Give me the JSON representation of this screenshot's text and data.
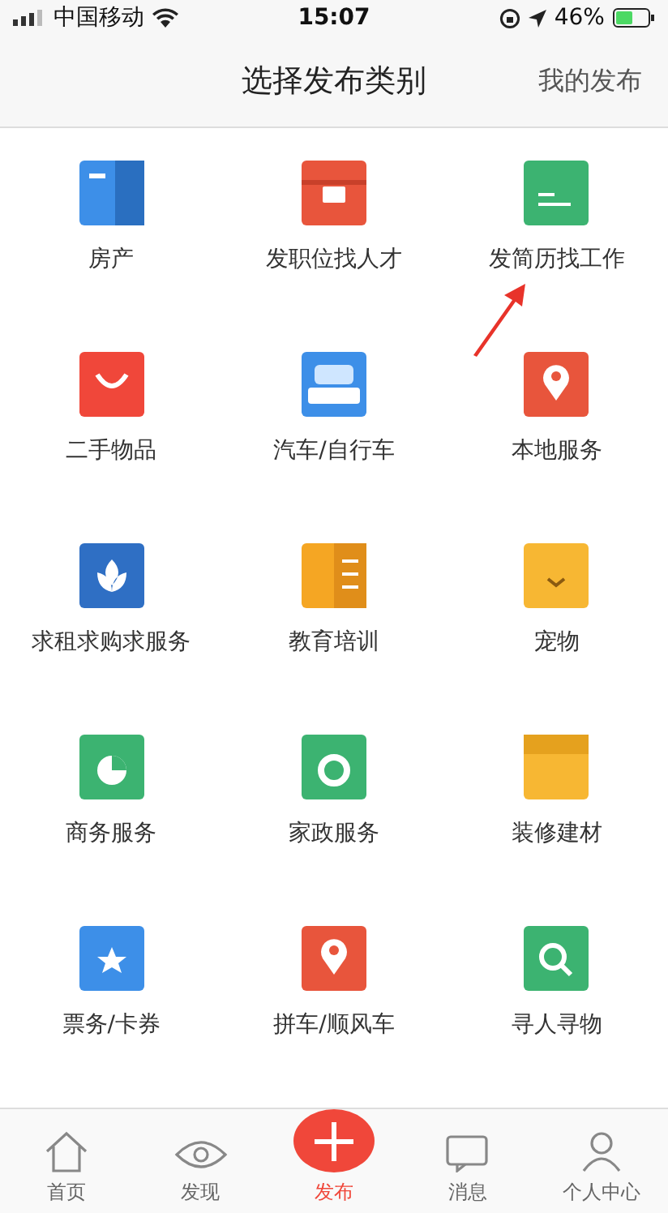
{
  "status_bar": {
    "carrier": "中国移动",
    "time": "15:07",
    "battery": "46%"
  },
  "header": {
    "title": "选择发布类别",
    "action": "我的发布"
  },
  "categories": [
    {
      "label": "房产"
    },
    {
      "label": "发职位找人才"
    },
    {
      "label": "发简历找工作"
    },
    {
      "label": "二手物品"
    },
    {
      "label": "汽车/自行车"
    },
    {
      "label": "本地服务"
    },
    {
      "label": "求租求购求服务"
    },
    {
      "label": "教育培训"
    },
    {
      "label": "宠物"
    },
    {
      "label": "商务服务"
    },
    {
      "label": "家政服务"
    },
    {
      "label": "装修建材"
    },
    {
      "label": "票务/卡券"
    },
    {
      "label": "拼车/顺风车"
    },
    {
      "label": "寻人寻物"
    }
  ],
  "tab_bar": [
    {
      "label": "首页",
      "selected": false
    },
    {
      "label": "发现",
      "selected": false
    },
    {
      "label": "发布",
      "selected": true
    },
    {
      "label": "消息",
      "selected": false
    },
    {
      "label": "个人中心",
      "selected": false
    }
  ]
}
